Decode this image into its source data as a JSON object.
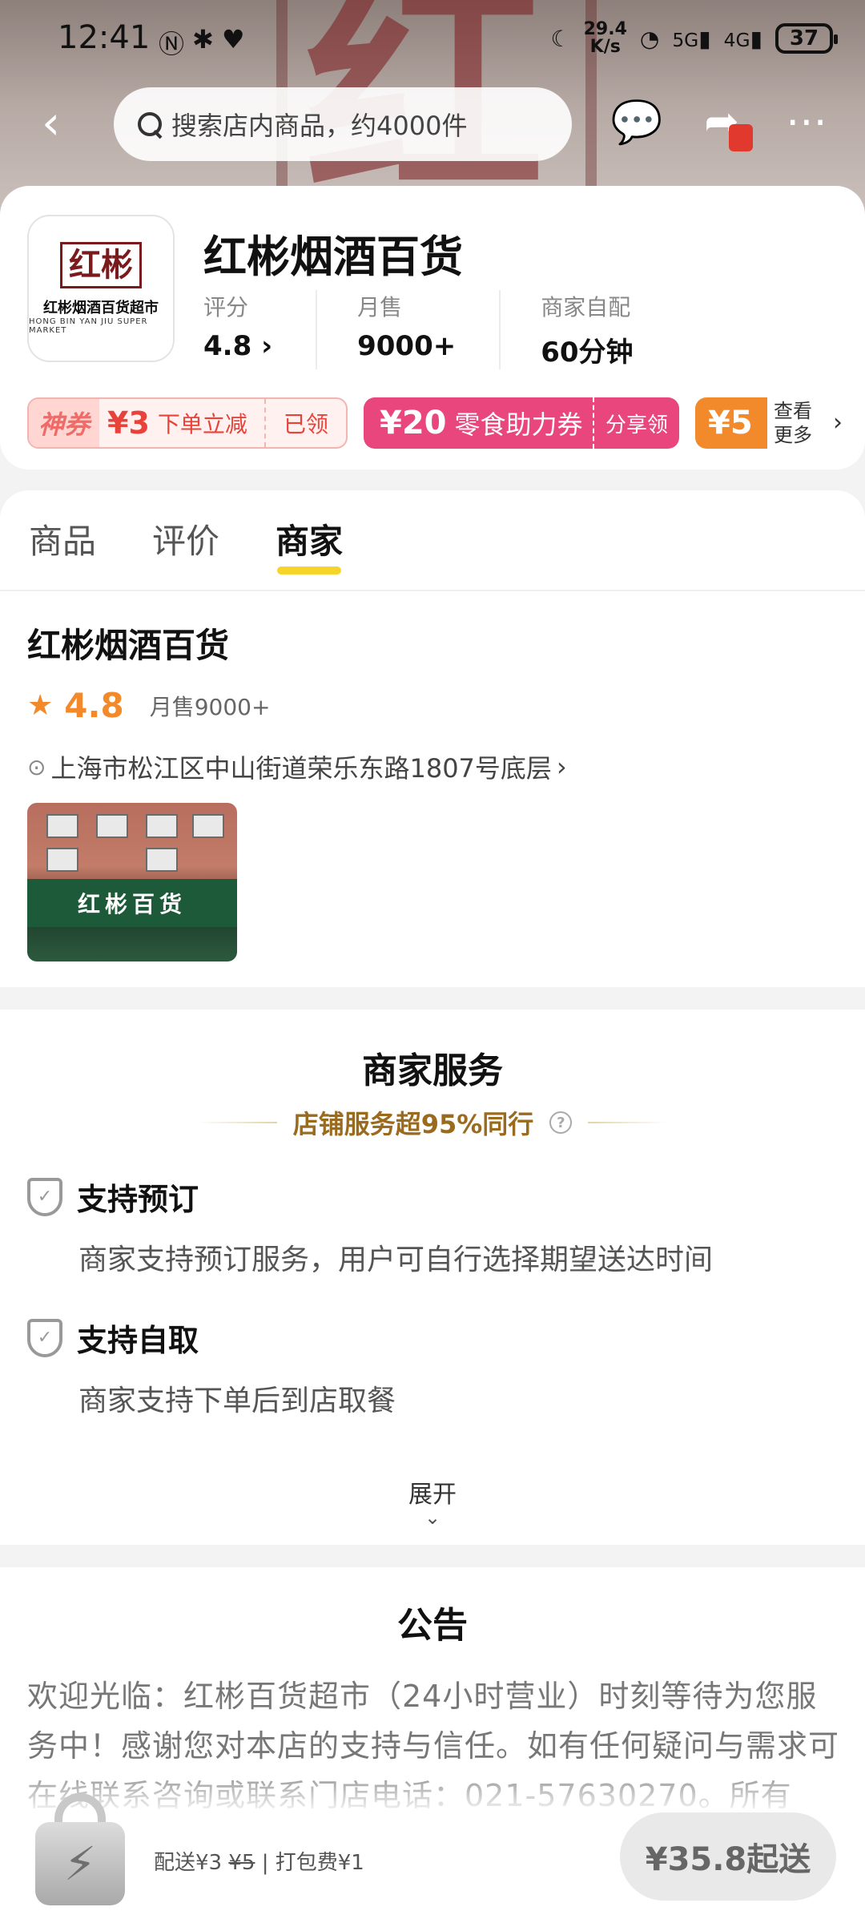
{
  "status_bar": {
    "time": "12:41",
    "net_speed_value": "29.4",
    "net_speed_unit": "K/s",
    "signal_5g": "5G",
    "signal_4g": "4G",
    "battery": "37"
  },
  "nav": {
    "search_placeholder": "搜索店内商品，约4000件"
  },
  "store": {
    "name": "红彬烟酒百货",
    "logo_mark": "红彬",
    "logo_name": "红彬烟酒百货超市",
    "logo_en": "HONG BIN YAN JIU SUPER MARKET",
    "stats": [
      {
        "label": "评分",
        "value": "4.8 ›"
      },
      {
        "label": "月售",
        "value": "9000+"
      },
      {
        "label": "商家自配",
        "value": "60分钟"
      }
    ],
    "coupons": {
      "c1_tag": "神券",
      "c1_amount": "¥3",
      "c1_text": "下单立减",
      "c1_status": "已领",
      "c2_amount": "¥20",
      "c2_text": "零食助力券",
      "c2_action": "分享领",
      "c3_amount": "¥5"
    },
    "more_label": "查看更多"
  },
  "tabs": [
    {
      "label": "商品"
    },
    {
      "label": "评价"
    },
    {
      "label": "商家"
    }
  ],
  "merchant": {
    "name": "红彬烟酒百货",
    "rating": "4.8",
    "monthly_sales": "月售9000+",
    "address": "上海市松江区中山街道荣乐东路1807号底层",
    "photo_sign": "红彬百货"
  },
  "services": {
    "title": "商家服务",
    "subtitle": "店铺服务超95%同行",
    "items": [
      {
        "name": "支持预订",
        "desc": "商家支持预订服务，用户可自行选择期望送达时间"
      },
      {
        "name": "支持自取",
        "desc": "商家支持下单后到店取餐"
      }
    ],
    "expand_label": "展开"
  },
  "notice": {
    "title": "公告",
    "body": "欢迎光临：红彬百货超市（24小时营业）时刻等待为您服务中！感谢您对本店的支持与信任。如有任何疑问与需求可在线联系咨询或联系门店电话：021-57630270。所有"
  },
  "cart": {
    "fee_prefix": "配送¥3",
    "fee_original": "¥5",
    "fee_suffix": " | 打包费¥1",
    "min_order": "¥35.8起送"
  },
  "colors": {
    "accent_yellow": "#f7d42a",
    "rating_orange": "#f28a2b",
    "coupon_pink": "#e8467d",
    "coupon_red": "#e8433b",
    "gold_text": "#9a6b1e"
  }
}
